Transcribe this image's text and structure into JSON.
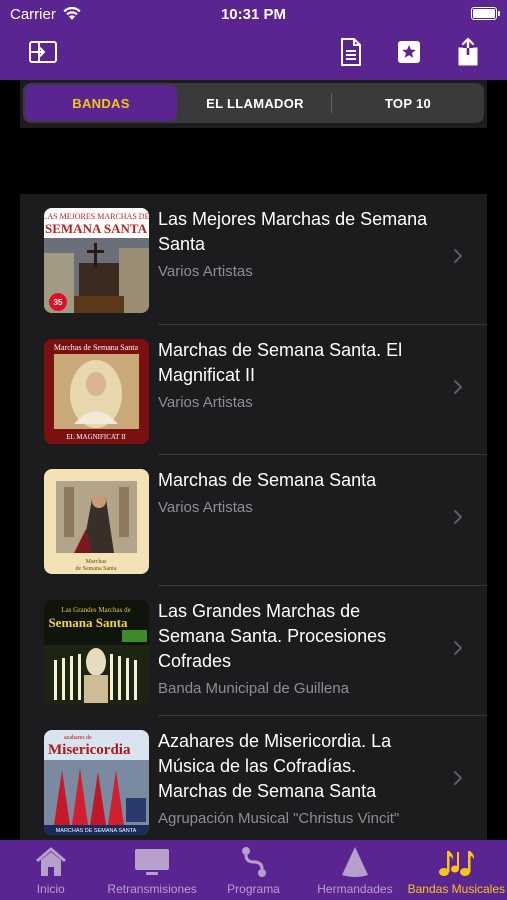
{
  "status_bar": {
    "carrier": "Carrier",
    "time": "10:31 PM"
  },
  "segments": [
    {
      "label": "BANDAS",
      "active": true
    },
    {
      "label": "EL LLAMADOR",
      "active": false
    },
    {
      "label": "TOP 10",
      "active": false
    }
  ],
  "albums": [
    {
      "title": "Las Mejores Marchas de Semana Santa",
      "artist": "Varios Artistas"
    },
    {
      "title": "Marchas de Semana Santa. El Magnificat II",
      "artist": "Varios Artistas"
    },
    {
      "title": "Marchas de Semana Santa",
      "artist": "Varios Artistas"
    },
    {
      "title": "Las Grandes Marchas de Semana Santa. Procesiones Cofrades",
      "artist": "Banda Municipal de Guillena"
    },
    {
      "title": "Azahares de Misericordia. La Música de las Cofradías. Marchas de Semana Santa",
      "artist": "Agrupación Musical \"Christus Vincit\""
    }
  ],
  "tab_bar": [
    {
      "label": "Inicio",
      "icon": "house-icon"
    },
    {
      "label": "Retransmisiones",
      "icon": "tv-icon"
    },
    {
      "label": "Programa",
      "icon": "route-icon"
    },
    {
      "label": "Hermandades",
      "icon": "cone-icon"
    },
    {
      "label": "Bandas Musicales",
      "icon": "music-notes-icon"
    }
  ],
  "colors": {
    "brand_purple": "#5b2591",
    "accent_yellow": "#f5c518",
    "cell_bg": "#1c1c1e"
  }
}
